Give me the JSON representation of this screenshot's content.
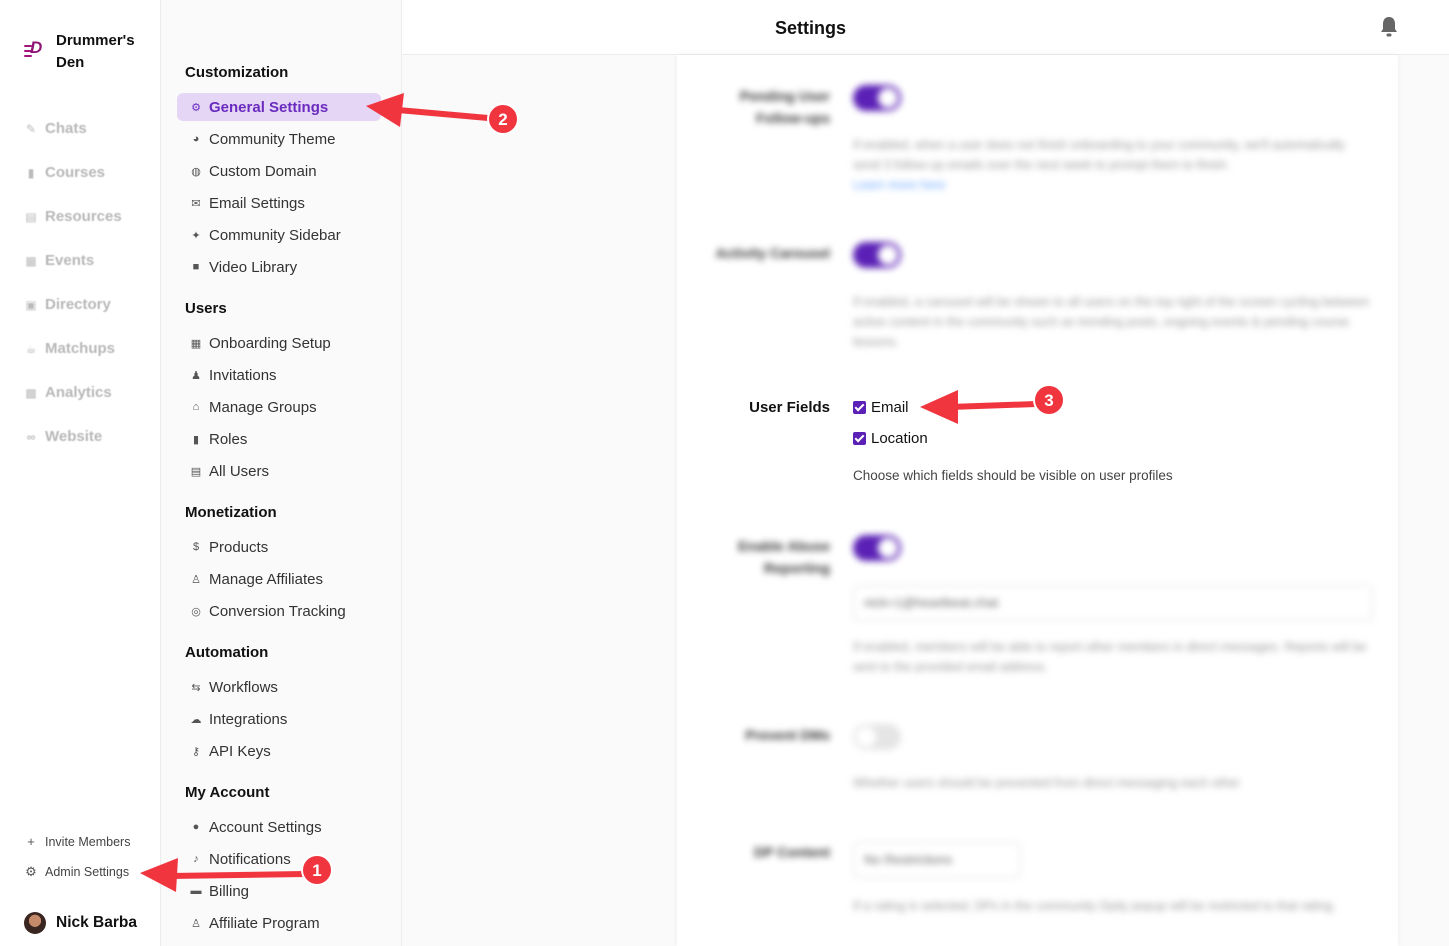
{
  "brand": {
    "name": "Drummer's Den"
  },
  "rail": {
    "items": [
      {
        "label": "Chats",
        "icon": "pencil-icon"
      },
      {
        "label": "Courses",
        "icon": "book-icon"
      },
      {
        "label": "Resources",
        "icon": "document-icon"
      },
      {
        "label": "Events",
        "icon": "calendar-icon"
      },
      {
        "label": "Directory",
        "icon": "contacts-icon"
      },
      {
        "label": "Matchups",
        "icon": "coffee-icon"
      },
      {
        "label": "Analytics",
        "icon": "chart-icon"
      },
      {
        "label": "Website",
        "icon": "link-icon"
      }
    ],
    "invite_label": "Invite Members",
    "admin_label": "Admin Settings",
    "user_name": "Nick Barba"
  },
  "settings_nav": {
    "sections": [
      {
        "title": "Customization",
        "items": [
          "General Settings",
          "Community Theme",
          "Custom Domain",
          "Email Settings",
          "Community Sidebar",
          "Video Library"
        ]
      },
      {
        "title": "Users",
        "items": [
          "Onboarding Setup",
          "Invitations",
          "Manage Groups",
          "Roles",
          "All Users"
        ]
      },
      {
        "title": "Monetization",
        "items": [
          "Products",
          "Manage Affiliates",
          "Conversion Tracking"
        ]
      },
      {
        "title": "Automation",
        "items": [
          "Workflows",
          "Integrations",
          "API Keys"
        ]
      },
      {
        "title": "My Account",
        "items": [
          "Account Settings",
          "Notifications",
          "Billing",
          "Affiliate Program"
        ]
      }
    ],
    "active": "General Settings"
  },
  "header": {
    "title": "Settings"
  },
  "settings": {
    "pending": {
      "label": "Pending User Follow-ups",
      "help": "If enabled, when a user does not finish onboarding to your community, we'll automatically send 3 follow-up emails over the next week to prompt them to finish.",
      "link": "Learn more here",
      "enabled": true
    },
    "carousel": {
      "label": "Activity Carousel",
      "help": "If enabled, a carousel will be shown to all users on the top right of the screen cycling between active content in the community such as trending posts, ongoing events & pending course lessons.",
      "enabled": true
    },
    "user_fields": {
      "label": "User Fields",
      "options": [
        "Email",
        "Location"
      ],
      "help": "Choose which fields should be visible on user profiles"
    },
    "abuse": {
      "label": "Enable Abuse Reporting",
      "email": "nick+1@heartbeat.chat",
      "help": "If enabled, members will be able to report other members in direct messages. Reports will be sent to the provided email address.",
      "enabled": true
    },
    "dms": {
      "label": "Prevent DMs",
      "help": "Whether users should be prevented from direct messaging each other",
      "enabled": false
    },
    "dp": {
      "label": "DP Content",
      "select": "No Restrictions",
      "help": "If a rating is selected, DPs in the community Dpity popup will be restricted to that rating."
    }
  },
  "annotations": [
    "1",
    "2",
    "3"
  ],
  "colors": {
    "accent": "#5b21b6",
    "active_bg": "#e6d6f5",
    "arrow": "#f0353f"
  }
}
